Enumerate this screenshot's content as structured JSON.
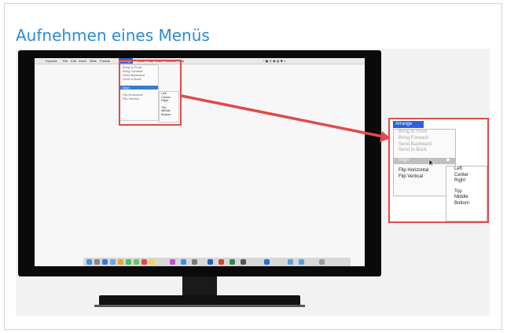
{
  "heading": "Aufnehmen eines Menüs",
  "colors": {
    "title": "#2a8bd6",
    "highlight": "#e04b4b",
    "menu_selection": "#2b63d8"
  },
  "menubar": {
    "apple": "",
    "items": [
      "Keynote",
      "File",
      "Edit",
      "Insert",
      "Slide",
      "Format"
    ],
    "selected": "Arrange",
    "after": [
      "View",
      "Play",
      "Share",
      "Window",
      "Help"
    ]
  },
  "mini_menu": {
    "items": [
      "Bring to Front",
      "Bring Forward",
      "Send Backward",
      "Send to Back"
    ],
    "align": "Align",
    "flips": [
      "Flip Horizontal",
      "Flip Vertical"
    ],
    "sub": [
      "Left",
      "Center",
      "Right",
      "Top",
      "Middle",
      "Bottom"
    ]
  },
  "zoom": {
    "menu_title": "Arrange",
    "items": [
      "Bring to Front",
      "Bring Forward",
      "Send Backward",
      "Send to Back"
    ],
    "align": "Align",
    "submenu_arrow": "▶",
    "flips": [
      "Flip Horizontal",
      "Flip Vertical"
    ],
    "submenu": [
      "Left",
      "Center",
      "Right",
      "Top",
      "Middle",
      "Bottom"
    ]
  },
  "dock_icons": [
    "finder-icon",
    "launchpad-icon",
    "safari-icon",
    "mail-icon",
    "photos-icon",
    "messages-icon",
    "maps-icon",
    "calendar-icon",
    "notes-icon",
    "music-icon",
    "app-store-icon",
    "settings-icon",
    "word-icon",
    "powerpoint-icon",
    "excel-icon",
    "trash-icon"
  ]
}
